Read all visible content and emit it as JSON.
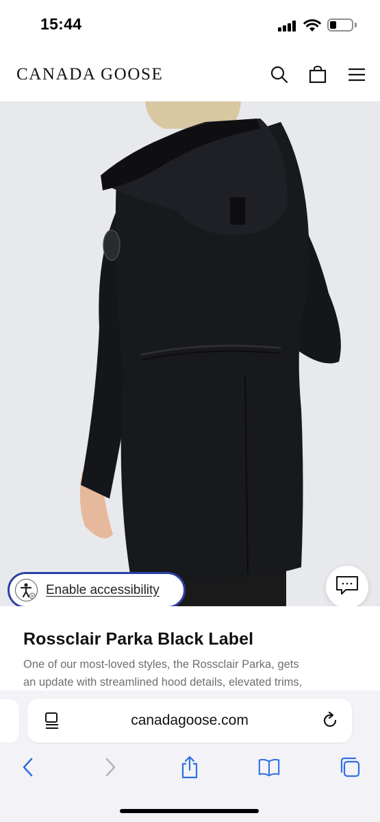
{
  "status_bar": {
    "time": "15:44",
    "signal_icon": "cellular-signal-icon",
    "wifi_icon": "wifi-icon",
    "battery_icon": "battery-icon",
    "battery_level": 0.22
  },
  "header": {
    "brand": "CANADA GOOSE",
    "icons": [
      "search-icon",
      "shopping-bag-icon",
      "menu-icon"
    ]
  },
  "product": {
    "image_subject": "black-parka-back-view",
    "title": "Rossclair Parka Black Label",
    "description_lines": [
      "One of our most-loved styles, the Rossclair Parka, gets",
      "an update with streamlined hood details, elevated trims,"
    ]
  },
  "accessibility": {
    "label": "Enable accessibility",
    "icon": "accessibility-person-icon",
    "accent_color": "#2b3fa6"
  },
  "chat": {
    "icon": "chat-bubble-icon"
  },
  "browser": {
    "url": "canadagoose.com",
    "page_menu_icon": "page-settings-icon",
    "reload_icon": "reload-icon",
    "toolbar": [
      "back-icon",
      "forward-icon",
      "share-icon",
      "bookmarks-icon",
      "tabs-icon"
    ]
  }
}
